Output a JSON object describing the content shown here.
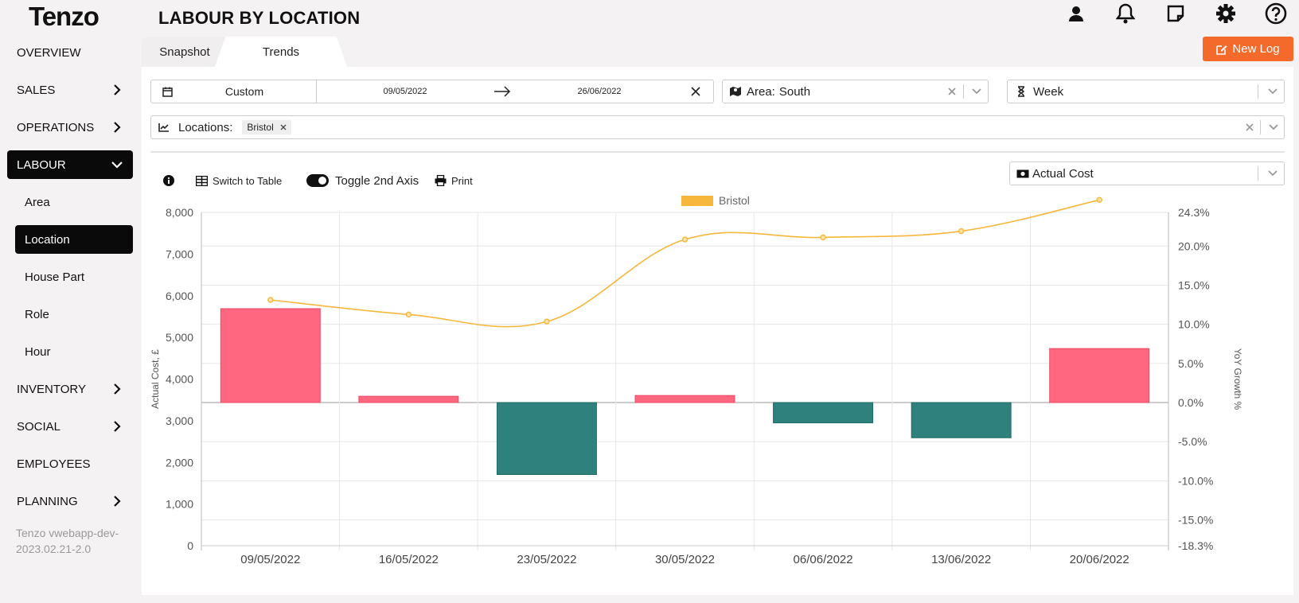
{
  "app": {
    "logo": "Tenzo",
    "title": "LABOUR BY LOCATION",
    "top_icons": [
      "user-icon",
      "bell-icon",
      "note-icon",
      "gear-icon",
      "help-icon"
    ]
  },
  "sidebar": {
    "items": [
      {
        "label": "OVERVIEW",
        "chevron": false
      },
      {
        "label": "SALES",
        "chevron": "right"
      },
      {
        "label": "OPERATIONS",
        "chevron": "right"
      },
      {
        "label": "LABOUR",
        "chevron": "down",
        "active": true
      },
      {
        "label": "Area",
        "sub": true
      },
      {
        "label": "Location",
        "sub": true,
        "active": true
      },
      {
        "label": "House Part",
        "sub": true
      },
      {
        "label": "Role",
        "sub": true
      },
      {
        "label": "Hour",
        "sub": true
      },
      {
        "label": "INVENTORY",
        "chevron": "right"
      },
      {
        "label": "SOCIAL",
        "chevron": "right"
      },
      {
        "label": "EMPLOYEES",
        "chevron": false
      },
      {
        "label": "PLANNING",
        "chevron": "right"
      }
    ],
    "version": "Tenzo vwebapp-dev-2023.02.21-2.0"
  },
  "tabs": {
    "snapshot": "Snapshot",
    "trends": "Trends"
  },
  "new_log_label": "New Log",
  "filters": {
    "date_mode": "Custom",
    "date_start": "09/05/2022",
    "date_end": "26/06/2022",
    "area_label": "Area:",
    "area_value": "South",
    "period": "Week",
    "locations_label": "Locations:",
    "location_tag": "Bristol"
  },
  "toolbar": {
    "switch_table": "Switch to Table",
    "toggle_axis": "Toggle 2nd Axis",
    "print": "Print",
    "metric": "Actual Cost"
  },
  "colors": {
    "accent": "#f46a2a",
    "positive_bar": "#ff6680",
    "negative_bar": "#2e817c",
    "line": "#f6b73c"
  },
  "chart_data": {
    "type": "bar",
    "categories": [
      "09/05/2022",
      "16/05/2022",
      "23/05/2022",
      "30/05/2022",
      "06/06/2022",
      "13/06/2022",
      "20/06/2022"
    ],
    "series": [
      {
        "name": "Bristol",
        "kind": "line",
        "axis": "left",
        "values": [
          5900,
          5550,
          5380,
          7350,
          7400,
          7550,
          8300
        ]
      },
      {
        "kind": "bar",
        "axis": "right",
        "values": [
          12.0,
          0.8,
          -9.2,
          0.9,
          -2.6,
          -4.5,
          6.9
        ]
      }
    ],
    "ylabel": "Actual Cost, £",
    "y2label": "YoY Growth %",
    "ylim": [
      0,
      8000
    ],
    "y2lim": [
      -18.3,
      24.3
    ],
    "yticks": [
      "0",
      "1,000",
      "2,000",
      "3,000",
      "4,000",
      "5,000",
      "6,000",
      "7,000",
      "8,000"
    ],
    "y2ticks": [
      "-18.3%",
      "-15.0%",
      "-10.0%",
      "-5.0%",
      "0.0%",
      "5.0%",
      "10.0%",
      "15.0%",
      "20.0%",
      "24.3%"
    ],
    "legend": "top-center",
    "grid": true
  }
}
